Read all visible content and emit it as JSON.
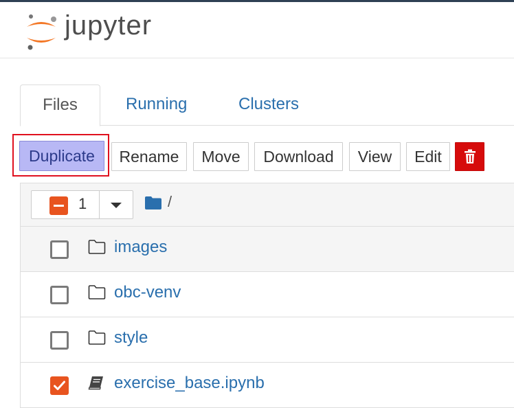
{
  "header": {
    "logo_text": "jupyter",
    "colors": {
      "accent_orange": "#f37726",
      "top_bar": "#2f4154"
    }
  },
  "tabs": [
    {
      "label": "Files",
      "active": true
    },
    {
      "label": "Running",
      "active": false
    },
    {
      "label": "Clusters",
      "active": false
    }
  ],
  "toolbar": {
    "duplicate_label": "Duplicate",
    "rename_label": "Rename",
    "move_label": "Move",
    "download_label": "Download",
    "view_label": "View",
    "edit_label": "Edit",
    "delete_icon": "trash-icon"
  },
  "list": {
    "selected_count": "1",
    "path": "/",
    "items": [
      {
        "name": "images",
        "type": "folder",
        "checked": false
      },
      {
        "name": "obc-venv",
        "type": "folder",
        "checked": false
      },
      {
        "name": "style",
        "type": "folder",
        "checked": false
      },
      {
        "name": "exercise_base.ipynb",
        "type": "notebook",
        "checked": true
      }
    ]
  }
}
